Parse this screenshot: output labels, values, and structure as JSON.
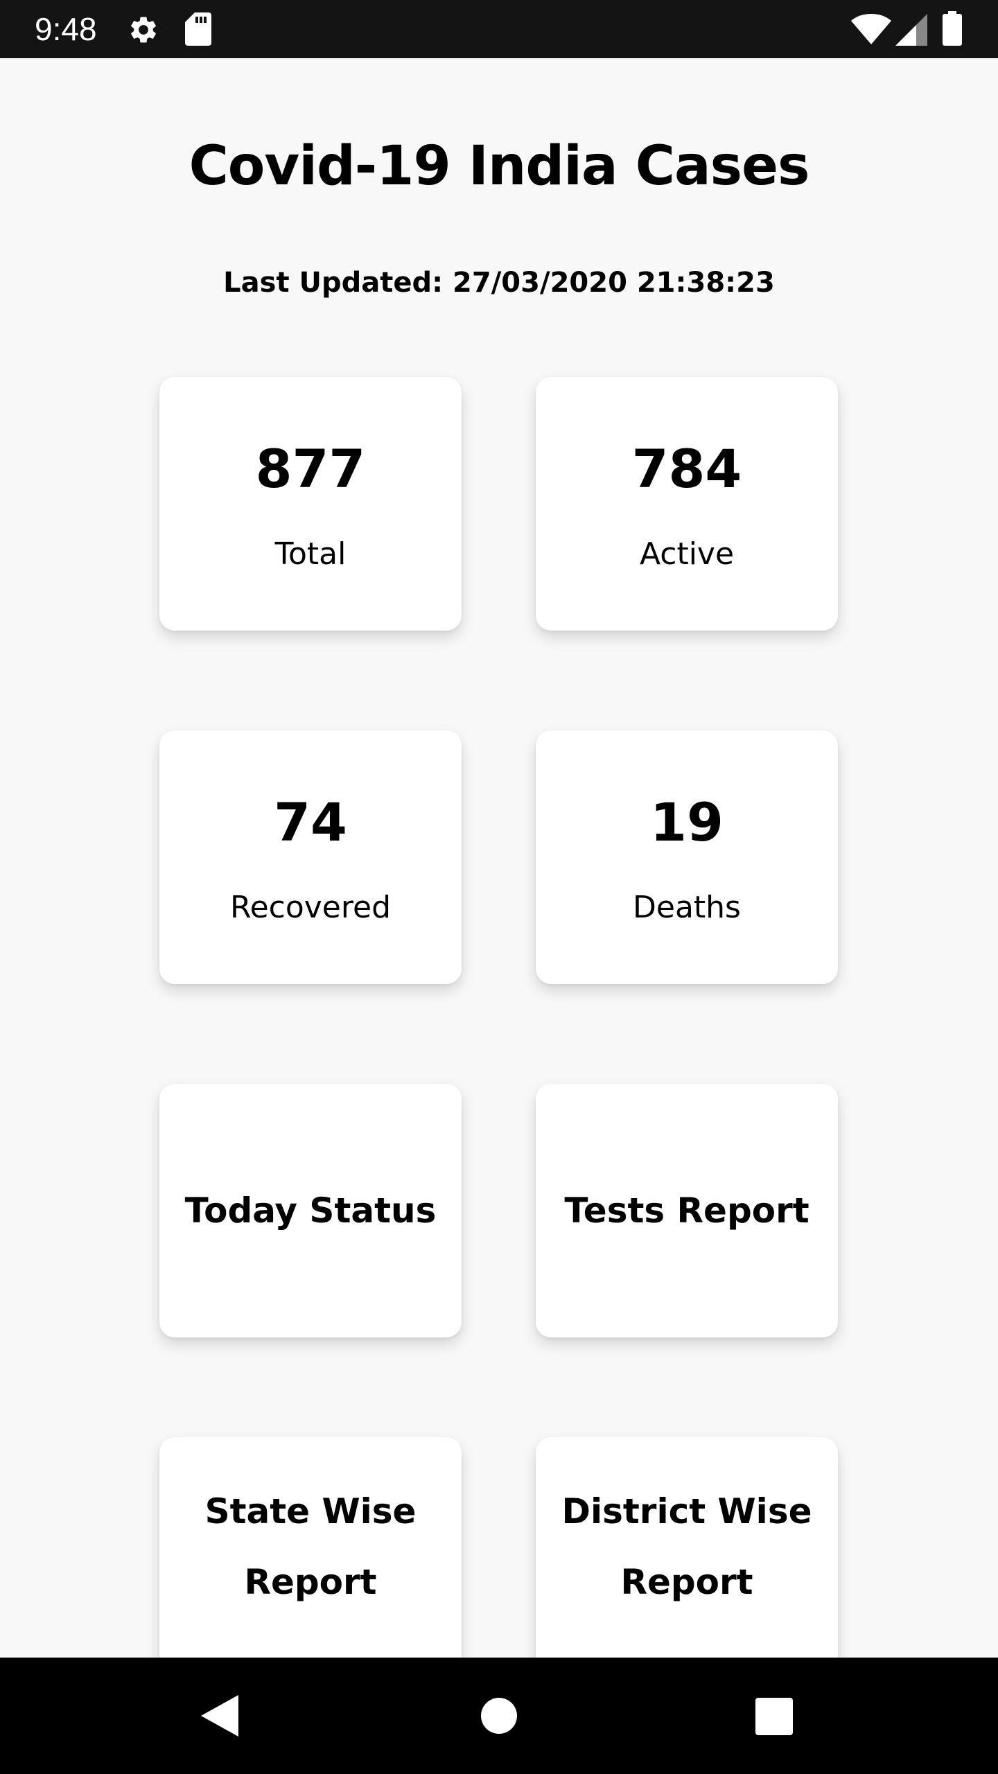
{
  "status_bar": {
    "time": "9:48",
    "icons": [
      "gear-icon",
      "sd-card-icon",
      "wifi-icon",
      "cell-signal-icon",
      "battery-icon"
    ]
  },
  "header": {
    "title": "Covid-19 India Cases",
    "last_updated": "Last Updated: 27/03/2020 21:38:23"
  },
  "stats": {
    "total": {
      "value": "877",
      "label": "Total"
    },
    "active": {
      "value": "784",
      "label": "Active"
    },
    "recovered": {
      "value": "74",
      "label": "Recovered"
    },
    "deaths": {
      "value": "19",
      "label": "Deaths"
    }
  },
  "actions": {
    "today_status": {
      "label": "Today Status"
    },
    "tests_report": {
      "label": "Tests Report"
    },
    "state_wise": {
      "label_line1": "State Wise",
      "label_line2": "Report"
    },
    "district_wise": {
      "label_line1": "District Wise",
      "label_line2": "Report"
    }
  },
  "nav_bar": {
    "buttons": [
      "back-icon",
      "home-icon",
      "recents-icon"
    ]
  },
  "colors": {
    "background": "#f8f8f8",
    "card": "#ffffff",
    "status_bar": "#141414",
    "nav_bar": "#000000",
    "text": "#000000"
  }
}
